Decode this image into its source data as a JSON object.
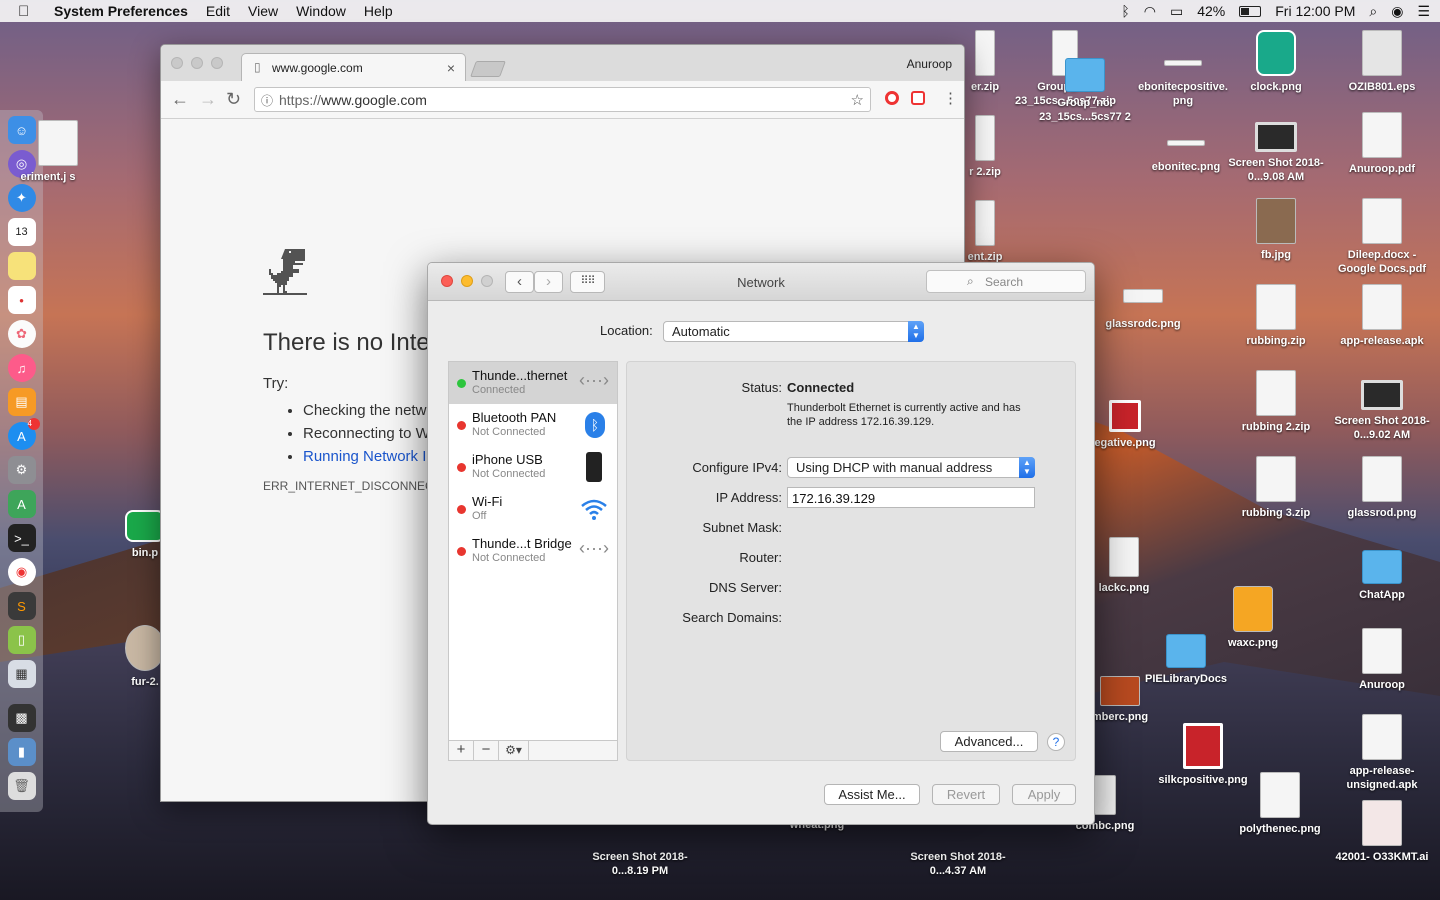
{
  "menubar": {
    "app_name": "System Preferences",
    "menus": [
      "Edit",
      "View",
      "Window",
      "Help"
    ],
    "battery": "42%",
    "clock": "Fri 12:00 PM"
  },
  "desktop": {
    "icons_left": [
      {
        "label": "eriment.j s"
      },
      {
        "label": "bin.p"
      },
      {
        "label": "fur-2."
      }
    ],
    "icons_top": [
      {
        "label": "er.zip"
      },
      {
        "label": "r 2.zip"
      },
      {
        "label": "ent.zip"
      },
      {
        "label": "Group_no. 23_15cs...5cs77.zip"
      },
      {
        "label": "Group_no. 23_15cs...5cs77 2"
      },
      {
        "label": "ebonitecpositive. png"
      },
      {
        "label": "ebonitec.png"
      },
      {
        "label": "glassrodc.png"
      },
      {
        "label": "egative.png"
      },
      {
        "label": "lackc.png"
      },
      {
        "label": "PIELibraryDocs"
      },
      {
        "label": "mberc.png"
      },
      {
        "label": "silkcpositive.png"
      },
      {
        "label": "combc.png"
      },
      {
        "label": "wheat.png"
      }
    ],
    "icons_right": [
      {
        "label": "clock.png"
      },
      {
        "label": "OZIB801.eps"
      },
      {
        "label": "Screen Shot 2018-0...9.08 AM"
      },
      {
        "label": "Anuroop.pdf"
      },
      {
        "label": "fb.jpg"
      },
      {
        "label": "Dileep.docx - Google Docs.pdf"
      },
      {
        "label": "rubbing.zip"
      },
      {
        "label": "app-release.apk"
      },
      {
        "label": "rubbing 2.zip"
      },
      {
        "label": "Screen Shot 2018-0...9.02 AM"
      },
      {
        "label": "rubbing 3.zip"
      },
      {
        "label": "glassrod.png"
      },
      {
        "label": "ChatApp"
      },
      {
        "label": "waxc.png"
      },
      {
        "label": "Anuroop"
      },
      {
        "label": "app-release- unsigned.apk"
      },
      {
        "label": "polythenec.png"
      },
      {
        "label": "42001- O33KMT.ai"
      }
    ],
    "icons_bottom": [
      {
        "label": "Screen Shot 2018-0...8.19 PM"
      },
      {
        "label": "Screen Shot 2018-0...4.37 AM"
      }
    ]
  },
  "chrome": {
    "tab_title": "www.google.com",
    "profile": "Anuroop",
    "url_proto": "https://",
    "url_host": "www.google.com",
    "error_title": "There is no Inte",
    "try_label": "Try:",
    "suggestions": [
      "Checking the netw",
      "Reconnecting to W"
    ],
    "diagnostics_link": "Running Network I",
    "error_code": "ERR_INTERNET_DISCONNECT"
  },
  "network": {
    "window_title": "Network",
    "search_placeholder": "Search",
    "location_label": "Location:",
    "location_value": "Automatic",
    "services": [
      {
        "name": "Thunde...thernet",
        "status": "Connected",
        "dot": "#2cc53d",
        "icon": "ethernet-icon"
      },
      {
        "name": "Bluetooth PAN",
        "status": "Not Connected",
        "dot": "#e8362f",
        "icon": "bluetooth-icon"
      },
      {
        "name": "iPhone USB",
        "status": "Not Connected",
        "dot": "#e8362f",
        "icon": "iphone-icon"
      },
      {
        "name": "Wi-Fi",
        "status": "Off",
        "dot": "#e8362f",
        "icon": "wifi-icon"
      },
      {
        "name": "Thunde...t Bridge",
        "status": "Not Connected",
        "dot": "#e8362f",
        "icon": "ethernet-icon"
      }
    ],
    "tools": [
      "+",
      "−",
      "⚙▾"
    ],
    "status_label": "Status:",
    "status_value": "Connected",
    "status_desc": "Thunderbolt Ethernet is currently active and has the IP address 172.16.39.129.",
    "configure_label": "Configure IPv4:",
    "configure_value": "Using DHCP with manual address",
    "ip_label": "IP Address:",
    "ip_value": "172.16.39.129",
    "subnet_label": "Subnet Mask:",
    "router_label": "Router:",
    "dns_label": "DNS Server:",
    "search_domains_label": "Search Domains:",
    "advanced_label": "Advanced...",
    "help_label": "?",
    "assist_label": "Assist Me...",
    "revert_label": "Revert",
    "apply_label": "Apply"
  },
  "dock": {
    "calendar_day": "13",
    "appstore_badge": "4"
  }
}
